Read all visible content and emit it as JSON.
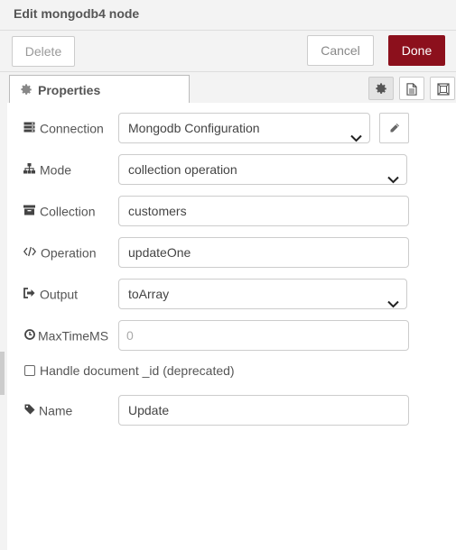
{
  "dialog": {
    "title": "Edit mongodb4 node",
    "delete_label": "Delete",
    "cancel_label": "Cancel",
    "done_label": "Done",
    "accent": "#8c101c"
  },
  "tabs": [
    {
      "label": "Properties",
      "icon": "cog-icon",
      "active": true
    }
  ],
  "tab_buttons": [
    {
      "icon": "cog-icon",
      "active": true
    },
    {
      "icon": "description-icon",
      "active": false
    },
    {
      "icon": "appearance-icon",
      "active": false
    }
  ],
  "form": {
    "connection": {
      "label": "Connection",
      "icon": "server-icon",
      "value": "Mongodb Configuration"
    },
    "mode": {
      "label": "Mode",
      "icon": "sitemap-icon",
      "value": "collection operation"
    },
    "collection": {
      "label": "Collection",
      "icon": "archive-icon",
      "value": "customers"
    },
    "operation": {
      "label": "Operation",
      "icon": "code-icon",
      "value": "updateOne"
    },
    "output": {
      "label": "Output",
      "icon": "sign-out-icon",
      "value": "toArray"
    },
    "maxtimems": {
      "label": "MaxTimeMS",
      "icon": "clock-icon",
      "placeholder": "0",
      "value": ""
    },
    "handle_id": {
      "label": "Handle document _id (deprecated)",
      "checked": false
    },
    "name": {
      "label": "Name",
      "icon": "tag-icon",
      "value": "Update"
    }
  }
}
